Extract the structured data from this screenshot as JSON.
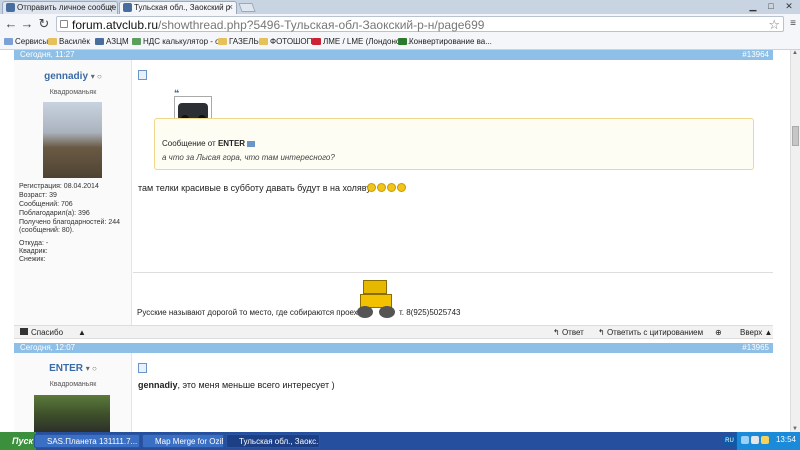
{
  "browser": {
    "tabs": [
      {
        "title": "Отправить личное сообще",
        "active": false
      },
      {
        "title": "Тульская обл., Заокский р",
        "active": true
      }
    ],
    "url_domain": "forum.atvclub.ru",
    "url_path": "/showthread.php?5496-Тульская-обл-Заокский-р-н/page699",
    "bookmarks": [
      "Сервисы",
      "Василёк",
      "АЗЦМ",
      "НДС калькулятор - о...",
      "ГАЗЕЛЬ",
      "ФОТОШОП",
      "ЛМЕ / LME (Лондонск...",
      "Конвертирование ва..."
    ]
  },
  "posts": [
    {
      "date": "Сегодня, 11:27",
      "number": "#13964",
      "username": "gennadiy",
      "usertitle": "Квадроманьяк",
      "stats": [
        "Регистрация:  08.04.2014",
        "Возраст:          39",
        "Сообщений:     706",
        "Поблагодарил(а):   396",
        "Получено благодарностей: 244",
        "(сообщений: 80).",
        "",
        "Откуда: -",
        "Квадрик:",
        "Снежик:"
      ],
      "quote_from_label": "Сообщение от",
      "quote_author": "ENTER",
      "quote_text": "а что за Лысая гора, что там интересного?",
      "text": "там телки красивые в субботу давать будут в на холяву",
      "signature": "Русские называют дорогой то место, где собираются проехать.",
      "signature_phone": "т. 8(925)5025743"
    },
    {
      "date": "Сегодня, 12:07",
      "number": "#13965",
      "username": "ENTER",
      "usertitle": "Квадроманьяк",
      "text_bold": "gennadiy",
      "text": ", это меня меньше всего интересует )"
    }
  ],
  "actions": {
    "thanks": "Спасибо",
    "reply": "Ответ",
    "reply_quote": "Ответить с цитированием",
    "top": "Вверх"
  },
  "taskbar": {
    "start": "Пуск",
    "tasks": [
      "SAS.Планета 131111.7...",
      "Map Merge for OziExplorer",
      "Тульская обл., Заокс..."
    ],
    "lang": "RU",
    "clock": "13:54"
  }
}
